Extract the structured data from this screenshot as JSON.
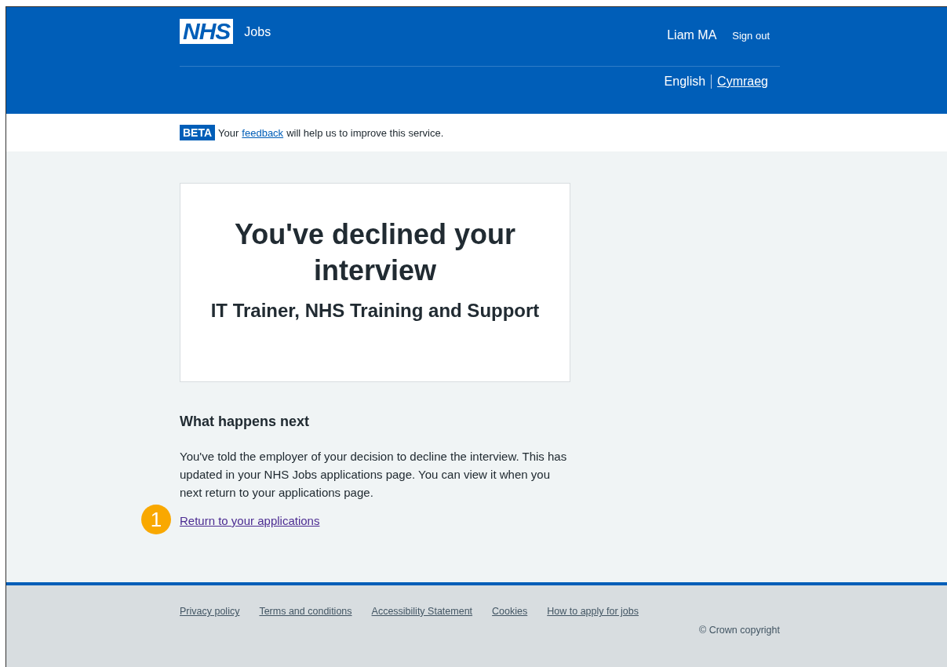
{
  "header": {
    "logo": "NHS",
    "service": "Jobs",
    "user": "Liam MA",
    "sign_out": "Sign out",
    "languages": [
      {
        "label": "English",
        "selected": true
      },
      {
        "label": "Cymraeg",
        "selected": false
      }
    ]
  },
  "beta_banner": {
    "tag": "BETA",
    "before": "Your",
    "link": "feedback",
    "after": "will help us to improve this service."
  },
  "panel": {
    "title": "You've declined your interview",
    "subtitle": "IT Trainer, NHS Training and Support"
  },
  "next_steps": {
    "heading": "What happens next",
    "body": "You've told the employer of your decision to decline the interview. This has updated in your NHS Jobs applications page. You can view it when you next return to your applications page.",
    "step_marker": "1",
    "link": "Return to your applications"
  },
  "footer": {
    "links": [
      "Privacy policy",
      "Terms and conditions",
      "Accessibility Statement",
      "Cookies",
      "How to apply for jobs"
    ],
    "copyright": "© Crown copyright"
  }
}
